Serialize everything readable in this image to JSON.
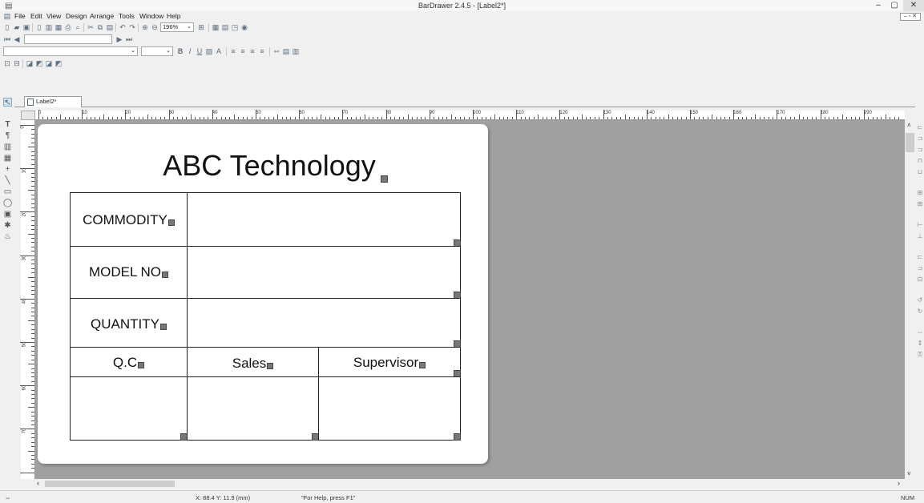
{
  "window": {
    "title": "BarDrawer 2.4.5 - [Label2*]",
    "minimize": "–",
    "maximize": "▢",
    "close": "✕"
  },
  "menu": [
    "File",
    "Edit",
    "View",
    "Design",
    "Arrange",
    "Tools",
    "Window",
    "Help"
  ],
  "toolbar": {
    "zoom": "196%"
  },
  "tab": {
    "label": "Label2*"
  },
  "ruler": {
    "h_ticks": [
      "0",
      "10",
      "20",
      "30",
      "40",
      "50",
      "60",
      "70",
      "80",
      "90",
      "100",
      "110",
      "120",
      "130",
      "140",
      "150",
      "160",
      "170",
      "180",
      "190"
    ],
    "v_ticks": [
      "0",
      "10",
      "20",
      "30",
      "40",
      "50",
      "60",
      "70"
    ]
  },
  "label": {
    "title": "ABC Technology",
    "rows": [
      "COMMODITY",
      "MODEL NO",
      "QUANTITY"
    ],
    "signoff": [
      "Q.C",
      "Sales",
      "Supervisor"
    ]
  },
  "status": {
    "coords": "X: 88.4 Y: 11.9 (mm)",
    "help": "\"For Help, press F1\"",
    "num": "NUM"
  }
}
